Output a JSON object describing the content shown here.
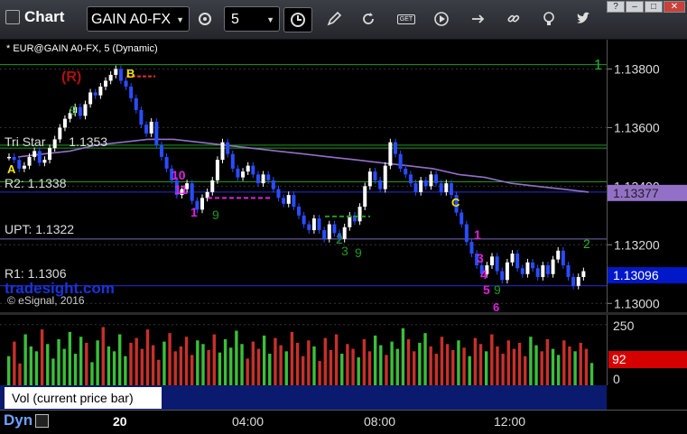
{
  "toolbar": {
    "app_title": "Chart",
    "symbol_value": "GAIN A0-FX",
    "interval_value": "5",
    "icons": [
      "settings-gear-icon",
      "clock-icon",
      "pencil-icon",
      "refresh-icon",
      "get-icon",
      "play-icon",
      "link-icon",
      "bulb-icon",
      "twitter-icon"
    ],
    "get_label": "GET"
  },
  "window_controls": [
    "?",
    "–",
    "□",
    "✕"
  ],
  "chart_header": "* EUR@GAIN A0-FX, 5 (Dynamic)",
  "annotations": {
    "r_label": "(R)",
    "a_label": "A",
    "b_label": "B",
    "c_label": "C",
    "tristar_label": "Tri Star",
    "tristar_value": "1.1353",
    "r2_label": "R2: 1.1338",
    "upt_label": "UPT: 1.1322",
    "r1_label": "R1: 1.1306",
    "watermark": "tradesight.com",
    "copyright": "© eSignal, 2016",
    "level_marker_1": "1",
    "level_marker_2": "2",
    "seq_magenta": [
      "10",
      "11",
      "1",
      "1",
      "3",
      "4",
      "5",
      "6"
    ],
    "seq_green": [
      "2",
      "3",
      "9",
      "9",
      "9",
      "9"
    ]
  },
  "price_axis": {
    "ticks": [
      "1.13800",
      "1.13600",
      "1.13400",
      "1.13200",
      "1.13000"
    ],
    "tag_purple": "1.13377",
    "tag_last": "1.13096",
    "colors": {
      "purple": "#9370c8",
      "last": "#0018c8"
    }
  },
  "volume_axis": {
    "ticks": [
      "250",
      "0"
    ],
    "tag_current": "92",
    "tag_color": "#d60000"
  },
  "volume_panel_label": "Vol (current price bar)",
  "close_glyph": "×",
  "time_axis": {
    "tab": "Dyn",
    "labels": [
      "20",
      "04:00",
      "08:00",
      "12:00"
    ]
  },
  "chart_data": [
    {
      "type": "bar",
      "title": "* EUR@GAIN A0-FX, 5 (Dynamic)",
      "xlabel": "",
      "ylabel": "",
      "ylim": [
        1.1297,
        1.139
      ],
      "x_tick_labels": [
        "20",
        "04:00",
        "08:00",
        "12:00"
      ],
      "series": [
        {
          "name": "Tri Star",
          "values": [
            1.1353
          ]
        },
        {
          "name": "R2",
          "values": [
            1.1338
          ]
        },
        {
          "name": "UPT",
          "values": [
            1.1322
          ]
        },
        {
          "name": "R1",
          "values": [
            1.1306
          ]
        }
      ],
      "close_series": [
        1.135,
        1.1349,
        1.1346,
        1.1347,
        1.135,
        1.1352,
        1.1348,
        1.1349,
        1.1353,
        1.1356,
        1.136,
        1.1363,
        1.1365,
        1.1367,
        1.1364,
        1.1368,
        1.1372,
        1.1371,
        1.1374,
        1.1376,
        1.1378,
        1.138,
        1.1376,
        1.1374,
        1.137,
        1.1366,
        1.1361,
        1.1358,
        1.1362,
        1.1354,
        1.135,
        1.1346,
        1.1342,
        1.1337,
        1.1339,
        1.1341,
        1.1335,
        1.1332,
        1.1336,
        1.1338,
        1.1342,
        1.1349,
        1.1355,
        1.1351,
        1.1346,
        1.1343,
        1.1345,
        1.1347,
        1.1344,
        1.1341,
        1.1344,
        1.1342,
        1.1339,
        1.1336,
        1.1334,
        1.1337,
        1.1333,
        1.133,
        1.1327,
        1.1325,
        1.1329,
        1.1325,
        1.1322,
        1.1327,
        1.1324,
        1.1322,
        1.1326,
        1.133,
        1.1328,
        1.1333,
        1.134,
        1.1345,
        1.1342,
        1.1339,
        1.1347,
        1.1355,
        1.1351,
        1.1346,
        1.1344,
        1.1341,
        1.1338,
        1.1342,
        1.134,
        1.1344,
        1.1341,
        1.1338,
        1.1341,
        1.1337,
        1.1331,
        1.1327,
        1.1321,
        1.1317,
        1.1313,
        1.131,
        1.1313,
        1.1316,
        1.1311,
        1.1308,
        1.1314,
        1.1317,
        1.1312,
        1.131,
        1.1314,
        1.1312,
        1.1309,
        1.1313,
        1.131,
        1.1315,
        1.1318,
        1.1313,
        1.1309,
        1.1306,
        1.1309,
        1.1311
      ],
      "ma_series": [
        1.135,
        1.1351,
        1.1352,
        1.1354,
        1.1355,
        1.1356,
        1.1356,
        1.1355,
        1.1354,
        1.1353,
        1.1352,
        1.1351,
        1.135,
        1.1349,
        1.1348,
        1.1347,
        1.1346,
        1.1344,
        1.1343,
        1.1341,
        1.134,
        1.1339,
        1.1338
      ],
      "volume_values": [
        120,
        180,
        90,
        210,
        160,
        140,
        230,
        170,
        110,
        190,
        150,
        220,
        130,
        200,
        175,
        95,
        185,
        240,
        160,
        140,
        210,
        120,
        175,
        195,
        150,
        230,
        165,
        105,
        180,
        215,
        140,
        160,
        200,
        125,
        185,
        170,
        145,
        210,
        135,
        190,
        155,
        225,
        170,
        110,
        180,
        150,
        205,
        130,
        195,
        165,
        140,
        220,
        175,
        120,
        185,
        160,
        100,
        195,
        145,
        210,
        130,
        170,
        150,
        115,
        190,
        140,
        205,
        165,
        125,
        180,
        150,
        235,
        190,
        140,
        175,
        215,
        160,
        130,
        200,
        170,
        145,
        185,
        155,
        120,
        195,
        170,
        140,
        210,
        160,
        130,
        185,
        150,
        175,
        120,
        200,
        165,
        140,
        190,
        150,
        125,
        185,
        160,
        140,
        175,
        150,
        92
      ],
      "volume_ylim": [
        0,
        290
      ]
    }
  ]
}
